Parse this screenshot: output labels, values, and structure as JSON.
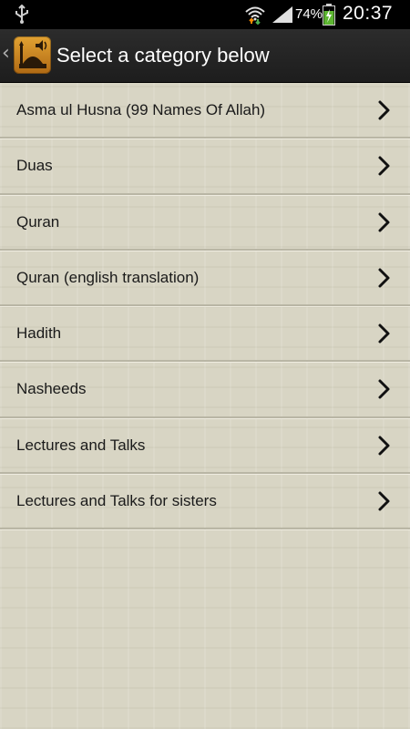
{
  "status_bar": {
    "battery_percent": "74%",
    "time": "20:37",
    "icons": [
      "usb-icon",
      "wifi-icon",
      "signal-icon",
      "battery-charging-icon"
    ]
  },
  "action_bar": {
    "title": "Select a category below",
    "app_icon": "mosque-speaker-icon",
    "up_icon": "chevron-left-icon"
  },
  "categories": [
    {
      "label": "Asma ul Husna (99 Names Of Allah)"
    },
    {
      "label": "Duas"
    },
    {
      "label": "Quran"
    },
    {
      "label": "Quran (english translation)"
    },
    {
      "label": "Hadith"
    },
    {
      "label": "Nasheeds"
    },
    {
      "label": "Lectures and Talks"
    },
    {
      "label": "Lectures and Talks for sisters"
    }
  ]
}
